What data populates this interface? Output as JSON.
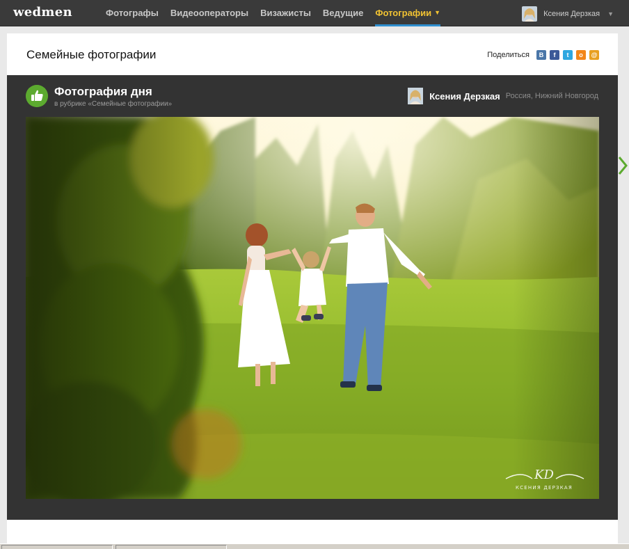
{
  "topbar": {
    "logo": "wedmen",
    "nav": [
      {
        "label": "Фотографы"
      },
      {
        "label": "Видеооператоры"
      },
      {
        "label": "Визажисты"
      },
      {
        "label": "Ведущие"
      },
      {
        "label": "Фотографии",
        "active": true
      }
    ],
    "user": {
      "name": "Ксения Дерзкая"
    }
  },
  "header": {
    "title": "Семейные фотографии",
    "share_label": "Поделиться",
    "share_buttons": [
      {
        "icon": "vkontakte-icon",
        "glyph": "В",
        "color": "#4a76a8"
      },
      {
        "icon": "facebook-icon",
        "glyph": "f",
        "color": "#3b5998"
      },
      {
        "icon": "twitter-icon",
        "glyph": "t",
        "color": "#2ea7e0"
      },
      {
        "icon": "odnoklassniki-icon",
        "glyph": "о",
        "color": "#f2861a"
      },
      {
        "icon": "mailru-icon",
        "glyph": "@",
        "color": "#e8a020"
      }
    ]
  },
  "photo_of_day": {
    "title": "Фотография дня",
    "subtitle": "в рубрике «Семейные фотографии»",
    "badge_icon": "thumbs-up-icon",
    "badge_color": "#5caa2f",
    "author_name": "Ксения Дерзкая",
    "author_location": "Россия, Нижний Новгород",
    "watermark": "КСЕНИЯ ДЕРЗКАЯ"
  },
  "colors": {
    "topbar": "#3a3a3a",
    "nav_active": "#f1c232",
    "nav_underline": "#2f8fcf",
    "panel": "#333333",
    "next_arrow": "#5caa2f"
  }
}
